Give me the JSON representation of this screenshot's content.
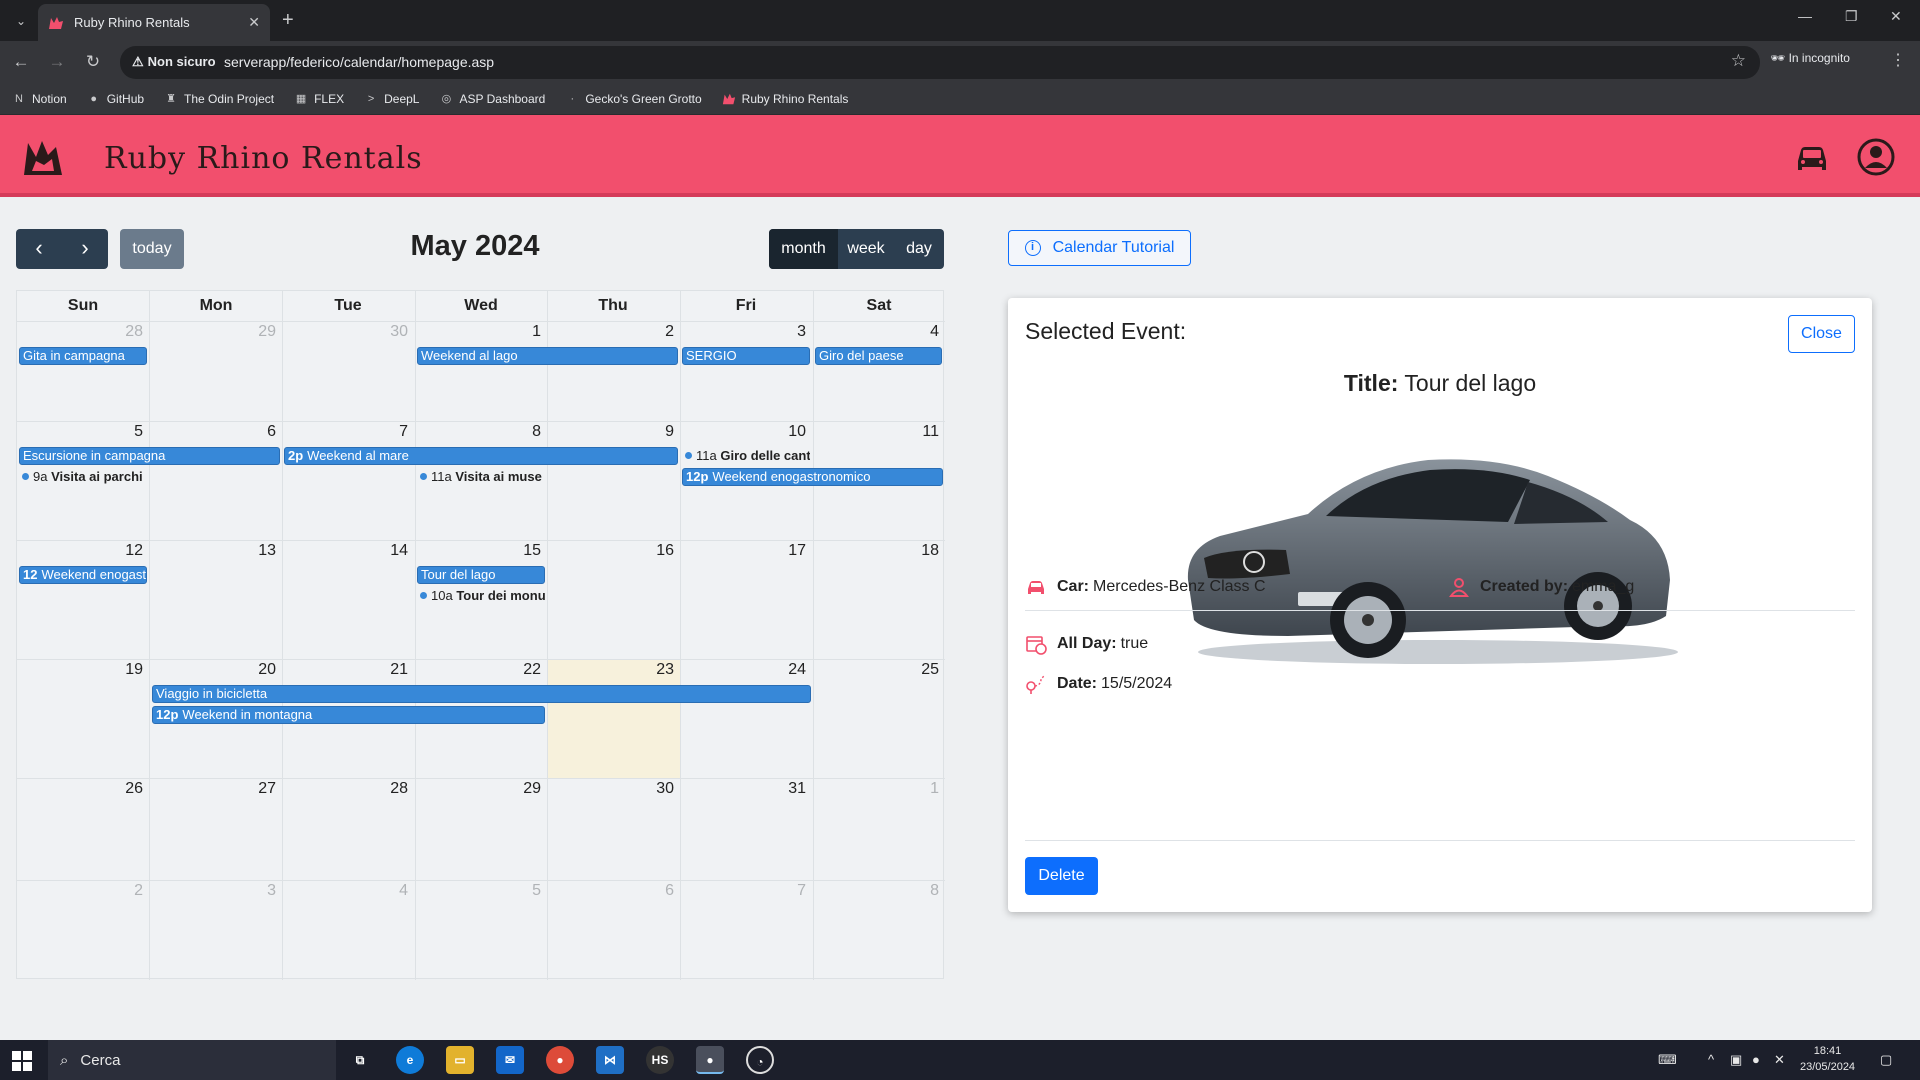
{
  "browser": {
    "tab_title": "Ruby Rhino Rentals",
    "security_label": "Non sicuro",
    "url": "serverapp/federico/calendar/homepage.asp",
    "incognito_label": "In incognito",
    "bookmarks": [
      "Notion",
      "GitHub",
      "The Odin Project",
      "FLEX",
      "DeepL",
      "ASP Dashboard",
      "Gecko's Green Grotto",
      "Ruby Rhino Rentals"
    ]
  },
  "app": {
    "brand": "Ruby Rhino Rentals",
    "header_color": "#f24f6d"
  },
  "calendar": {
    "title": "May 2024",
    "today_label": "today",
    "views": [
      "month",
      "week",
      "day"
    ],
    "active_view": "month",
    "weekdays": [
      "Sun",
      "Mon",
      "Tue",
      "Wed",
      "Thu",
      "Fri",
      "Sat"
    ],
    "weeks": [
      [
        "28",
        "29",
        "30",
        "1",
        "2",
        "3",
        "4"
      ],
      [
        "5",
        "6",
        "7",
        "8",
        "9",
        "10",
        "11"
      ],
      [
        "12",
        "13",
        "14",
        "15",
        "16",
        "17",
        "18"
      ],
      [
        "19",
        "20",
        "21",
        "22",
        "23",
        "24",
        "25"
      ],
      [
        "26",
        "27",
        "28",
        "29",
        "30",
        "31",
        "1"
      ],
      [
        "2",
        "3",
        "4",
        "5",
        "6",
        "7",
        "8"
      ]
    ],
    "events": {
      "gita": "Gita in campagna",
      "weekend_lago": "Weekend al lago",
      "sergio": "SERGIO",
      "giro_paese": "Giro del paese",
      "escursione": "Escursione in campagna",
      "weekend_mare_time": "2p",
      "weekend_mare": "Weekend al mare",
      "giro_cantine_time": "11a",
      "giro_cantine": "Giro delle cant",
      "enogastro_time": "12p",
      "enogastro": "Weekend enogastronomico",
      "visita_parchi_time": "9a",
      "visita_parchi": "Visita ai parchi",
      "visita_musei_time": "11a",
      "visita_musei": "Visita ai muse",
      "enogast_cont_time": "12",
      "enogast_cont": "Weekend enogast",
      "tour_lago": "Tour del lago",
      "tour_monu_time": "10a",
      "tour_monu": "Tour dei monu",
      "viaggio": "Viaggio in bicicletta",
      "montagna_time": "12p",
      "montagna": "Weekend in montagna"
    },
    "event_color": "#3788d8"
  },
  "tutorial_label": "Calendar Tutorial",
  "selected_event": {
    "heading": "Selected Event:",
    "close_label": "Close",
    "title_label": "Title:",
    "title": "Tour del lago",
    "car_label": "Car:",
    "car": "Mercedes-Benz Class C",
    "created_by_label": "Created by:",
    "created_by": "emma_g",
    "all_day_label": "All Day:",
    "all_day": "true",
    "date_label": "Date:",
    "date": "15/5/2024",
    "delete_label": "Delete"
  },
  "taskbar": {
    "search_placeholder": "Cerca",
    "time": "18:41",
    "date": "23/05/2024"
  }
}
